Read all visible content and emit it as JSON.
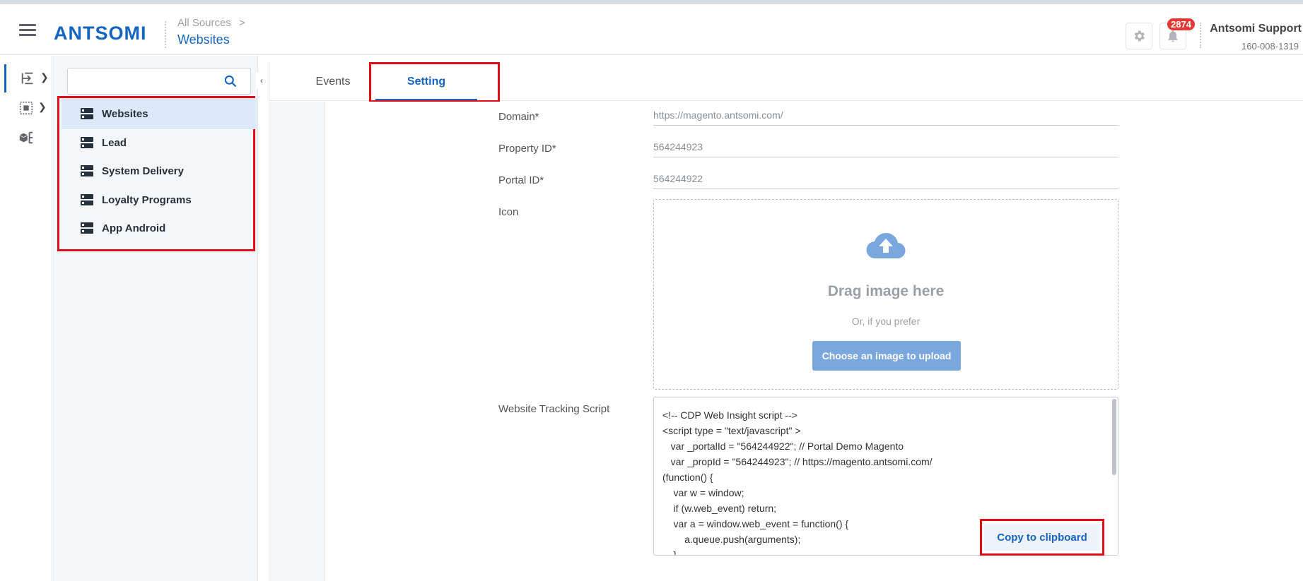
{
  "app": {
    "logo": "ANTSOMI",
    "breadcrumb": {
      "parent": "All Sources",
      "separator": ">",
      "title": "Websites"
    }
  },
  "header": {
    "notification_count": "2874",
    "user_name": "Antsomi Support",
    "user_id": "160-008-1319"
  },
  "rail": {
    "items": [
      {
        "icon": "data-import-icon",
        "active": true
      },
      {
        "icon": "data-group-icon",
        "active": false
      },
      {
        "icon": "box-hierarchy-icon",
        "active": false
      }
    ]
  },
  "sidebar": {
    "search_placeholder": "",
    "items": [
      {
        "label": "Websites",
        "selected": true
      },
      {
        "label": "Lead",
        "selected": false
      },
      {
        "label": "System Delivery",
        "selected": false
      },
      {
        "label": "Loyalty Programs",
        "selected": false
      },
      {
        "label": "App Android",
        "selected": false
      }
    ]
  },
  "tabs": [
    {
      "label": "Events",
      "active": false
    },
    {
      "label": "Setting",
      "active": true
    }
  ],
  "form": {
    "domain": {
      "label": "Domain*",
      "value": "https://magento.antsomi.com/"
    },
    "property_id": {
      "label": "Property ID*",
      "value": "564244923"
    },
    "portal_id": {
      "label": "Portal ID*",
      "value": "564244922"
    },
    "icon": {
      "label": "Icon",
      "drag_title": "Drag image here",
      "drag_sub": "Or, if you prefer",
      "upload_button": "Choose an image to upload"
    },
    "script": {
      "label": "Website Tracking Script",
      "code": "<!-- CDP Web Insight script -->\n<script type = \"text/javascript\" >\n   var _portalId = \"564244922\"; // Portal Demo Magento\n   var _propId = \"564244923\"; // https://magento.antsomi.com/\n(function() {\n    var w = window;\n    if (w.web_event) return;\n    var a = window.web_event = function() {\n        a.queue.push(arguments);\n    }",
      "copy_button": "Copy to clipboard"
    }
  },
  "colors": {
    "brand": "#1565c0",
    "highlight": "#e30d17",
    "badge": "#e53935"
  }
}
